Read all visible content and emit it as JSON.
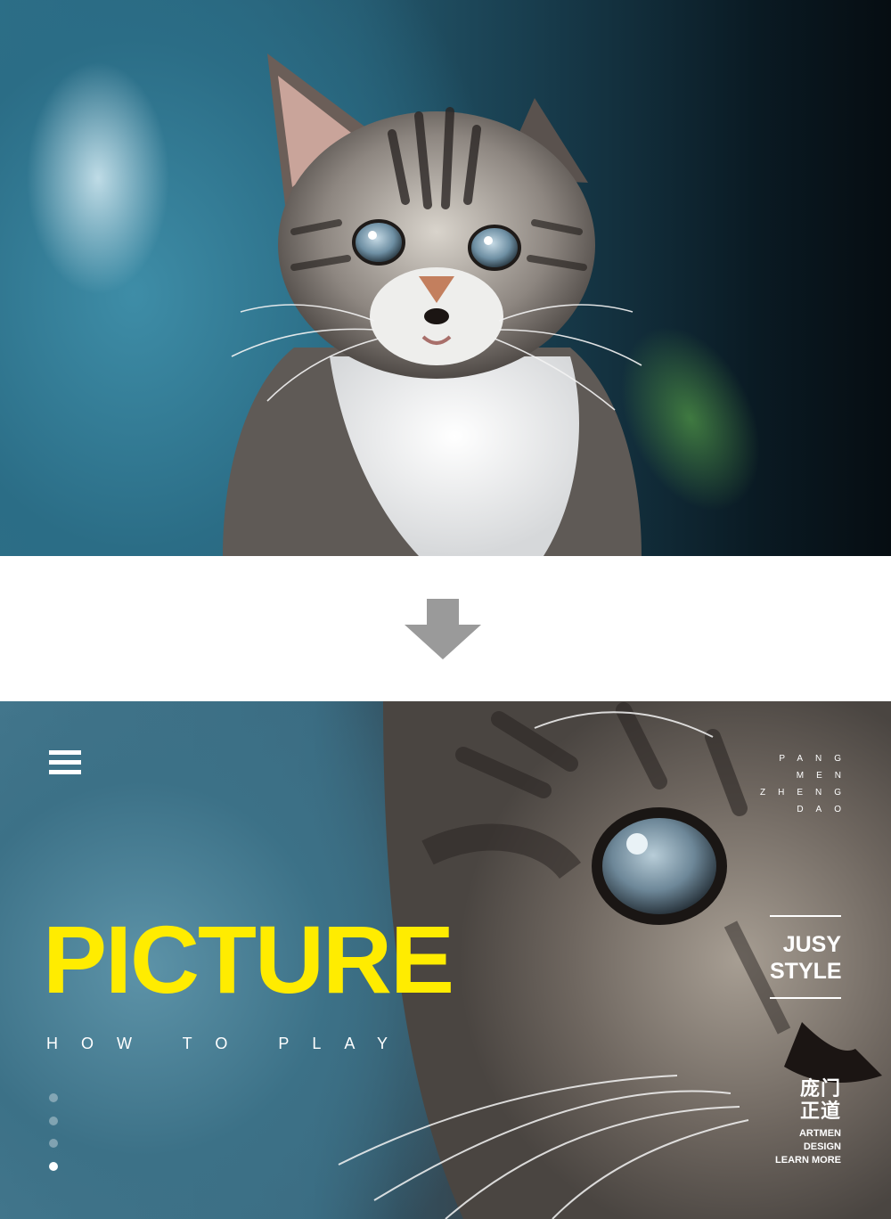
{
  "top_photo": {
    "subject": "cat-photo",
    "colors": {
      "bg_left": "#2e6f88",
      "bg_right": "#060d12"
    }
  },
  "arrow": {
    "icon": "down-arrow-icon",
    "color": "#9a9a9a"
  },
  "bottom_photo": {
    "subject": "cat-close-up-photo",
    "menu_icon": "hamburger-menu-icon",
    "side_words": [
      "PANG",
      "MEN",
      "ZHENG",
      "DAO"
    ],
    "headline": "PICTURE",
    "subline": "HOW TO PLAY",
    "style_lines": [
      "JUSY",
      "STYLE"
    ],
    "brand_cn": [
      "庞门",
      "正道"
    ],
    "brand_en": [
      "ARTMEN",
      "DESIGN",
      "LEARN MORE"
    ],
    "slides": {
      "count": 4,
      "active": 4
    },
    "colors": {
      "headline": "#ffec00",
      "text": "#ffffff"
    }
  }
}
